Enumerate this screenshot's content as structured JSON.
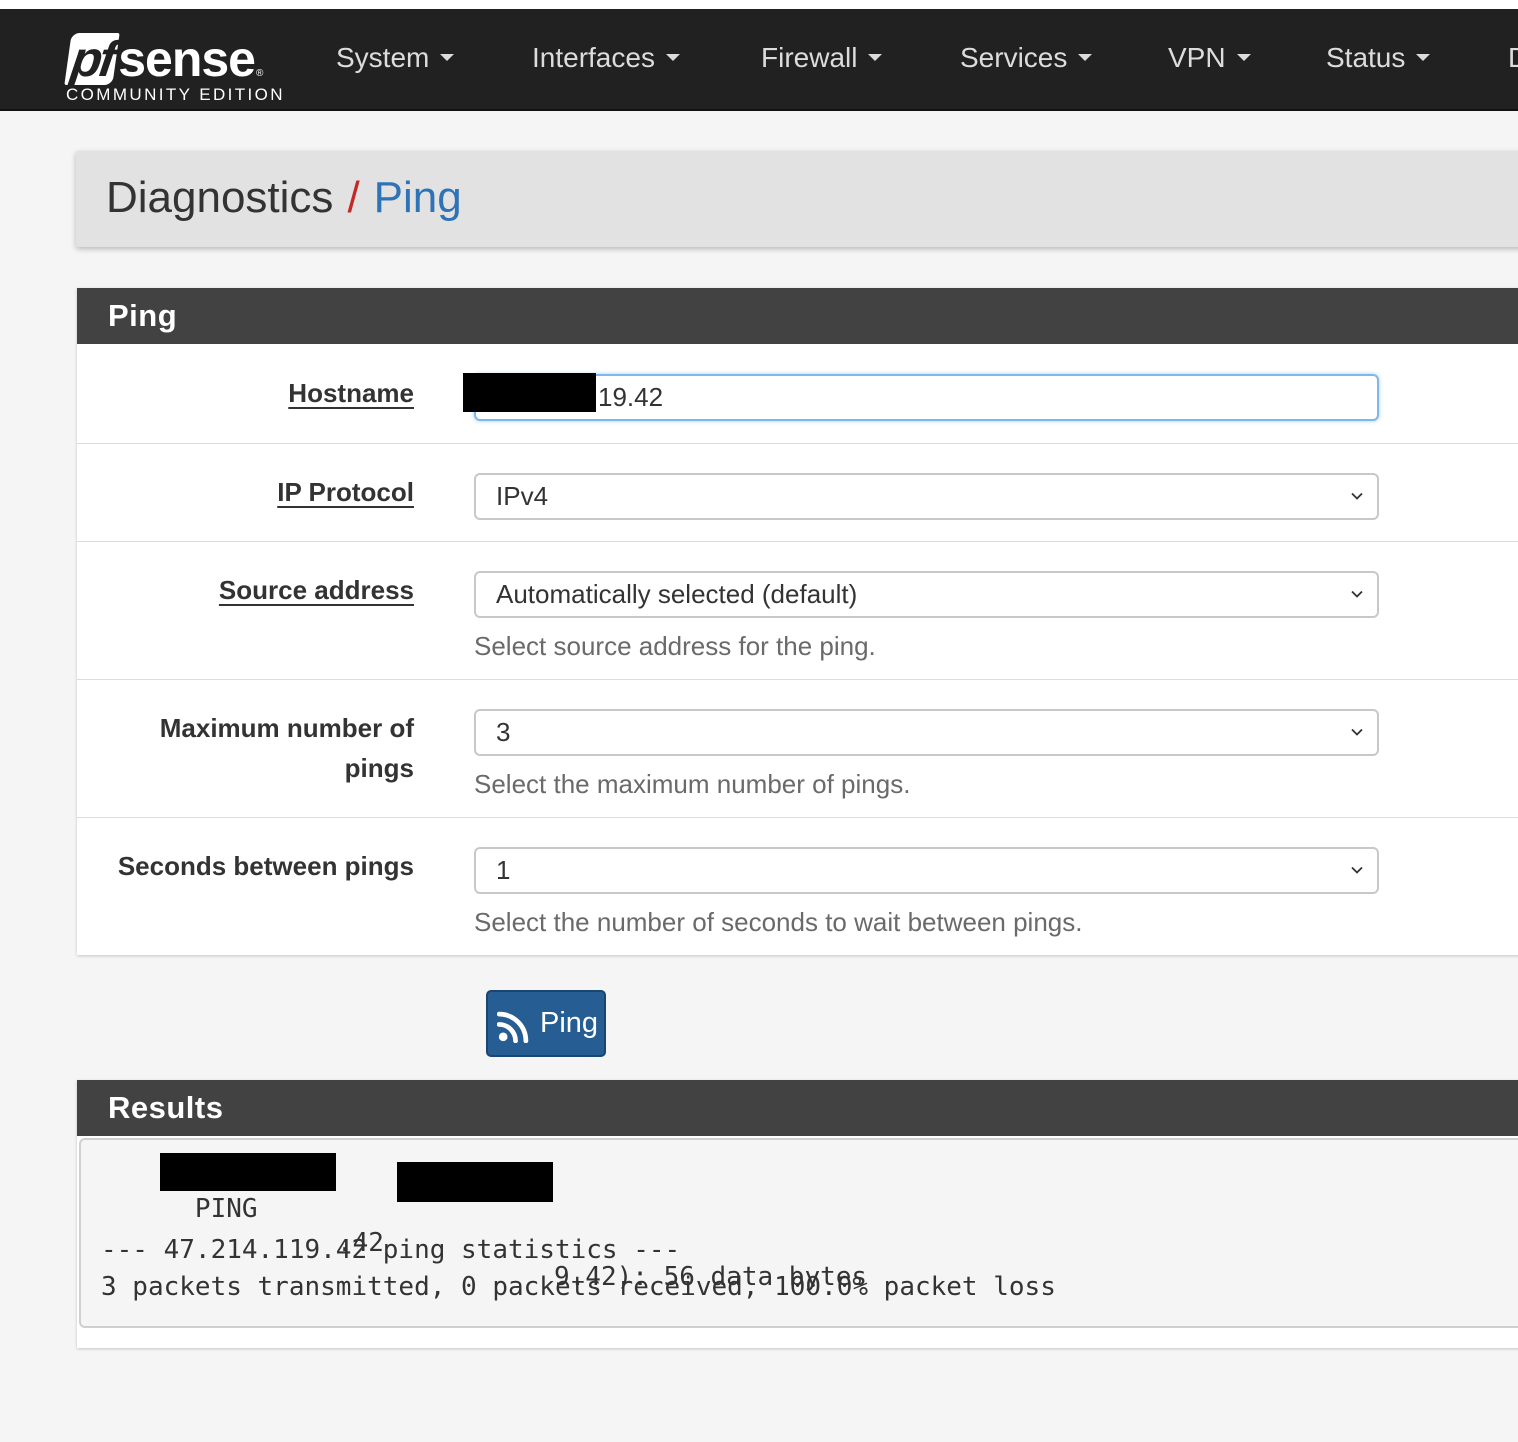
{
  "brand": {
    "pf": "pf",
    "sense": "sense",
    "trademark": "®",
    "edition": "COMMUNITY EDITION"
  },
  "nav": {
    "items": [
      {
        "label": "System"
      },
      {
        "label": "Interfaces"
      },
      {
        "label": "Firewall"
      },
      {
        "label": "Services"
      },
      {
        "label": "VPN"
      },
      {
        "label": "Status"
      },
      {
        "label": "D"
      }
    ]
  },
  "breadcrumb": {
    "root": "Diagnostics",
    "separator": "/",
    "current": "Ping"
  },
  "ping_panel": {
    "title": "Ping",
    "hostname": {
      "label": "Hostname",
      "value": "19.42"
    },
    "ip_protocol": {
      "label": "IP Protocol",
      "selected": "IPv4"
    },
    "source_address": {
      "label": "Source address",
      "selected": "Automatically selected (default)",
      "help": "Select source address for the ping."
    },
    "max_pings": {
      "label_line1": "Maximum number of",
      "label_line2": "pings",
      "selected": "3",
      "help": "Select the maximum number of pings."
    },
    "seconds_between": {
      "label": "Seconds between pings",
      "selected": "1",
      "help": "Select the number of seconds to wait between pings."
    }
  },
  "ping_button": {
    "label": "Ping"
  },
  "results": {
    "title": "Results",
    "line1_prefix": "PING",
    "line1_mid": ".42",
    "line1_suffix": "9.42): 56 data bytes",
    "line2": "--- 47.214.119.42 ping statistics ---",
    "line3": "3 packets transmitted, 0 packets received, 100.0% packet loss"
  },
  "colors": {
    "navbar": "#212121",
    "panel_heading": "#424242",
    "breadcrumb_separator": "#c62828",
    "breadcrumb_current": "#2f73b7",
    "button": "#265d92",
    "page_background": "#f5f5f5"
  }
}
